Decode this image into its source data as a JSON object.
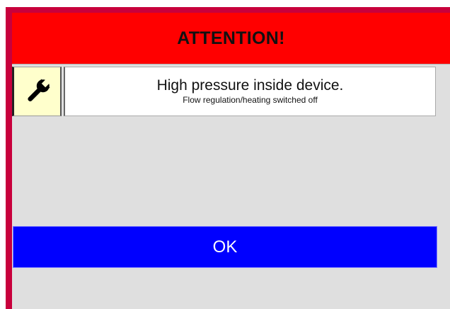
{
  "dialog": {
    "title": "ATTENTION!",
    "icon": "wrench-icon",
    "message": "High pressure inside device.",
    "submessage": "Flow regulation/heating switched off",
    "ok_label": "OK"
  },
  "colors": {
    "frame": "#c8003c",
    "title_bg": "#ff0000",
    "icon_bg": "#ffffcc",
    "ok_bg": "#0000ff",
    "panel_bg": "#dfdfdf"
  }
}
